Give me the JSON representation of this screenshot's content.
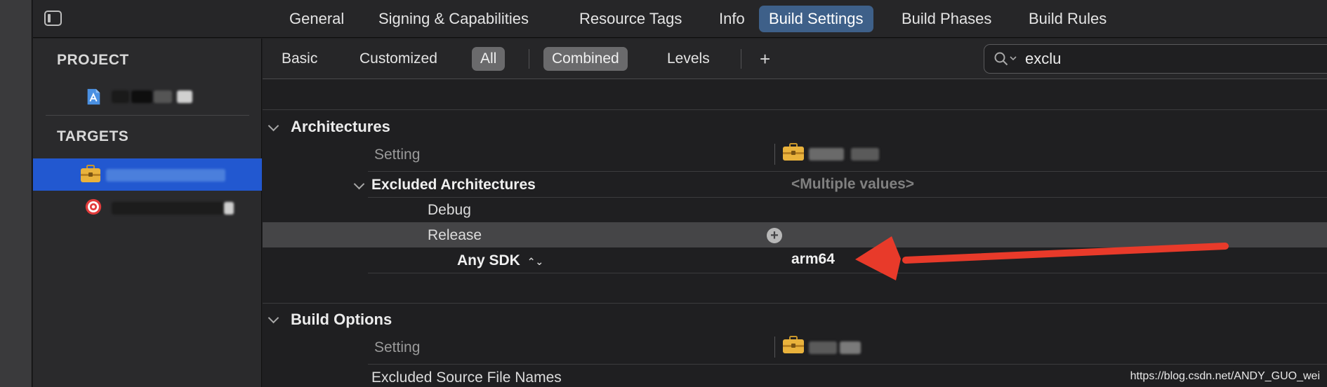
{
  "topbar": {
    "tabs": [
      {
        "label": "General",
        "active": false
      },
      {
        "label": "Signing & Capabilities",
        "active": false
      },
      {
        "label": "Resource Tags",
        "active": false
      },
      {
        "label": "Info",
        "active": false
      },
      {
        "label": "Build Settings",
        "active": true
      },
      {
        "label": "Build Phases",
        "active": false
      },
      {
        "label": "Build Rules",
        "active": false
      }
    ]
  },
  "sidebar": {
    "project_heading": "PROJECT",
    "targets_heading": "TARGETS",
    "project_icon": "xcode-project-icon",
    "target_icons": [
      "briefcase-icon",
      "target-icon"
    ]
  },
  "filterbar": {
    "basic": "Basic",
    "customized": "Customized",
    "all": "All",
    "combined": "Combined",
    "levels": "Levels",
    "add": "+",
    "search_value": "exclu"
  },
  "content": {
    "architectures": {
      "title": "Architectures",
      "setting_label": "Setting",
      "excluded_arch_label": "Excluded Architectures",
      "excluded_arch_value": "<Multiple values>",
      "debug_label": "Debug",
      "release_label": "Release",
      "any_sdk_label": "Any SDK",
      "any_sdk_stepper": "⌃⌄",
      "any_sdk_value": "arm64"
    },
    "build_options": {
      "title": "Build Options",
      "setting_label": "Setting",
      "excluded_source_label": "Excluded Source File Names"
    }
  },
  "colors": {
    "accent_tab": "#3e6089",
    "selection": "#2258d0",
    "annotation_arrow": "#e83a2a"
  },
  "watermark": "https://blog.csdn.net/ANDY_GUO_wei"
}
